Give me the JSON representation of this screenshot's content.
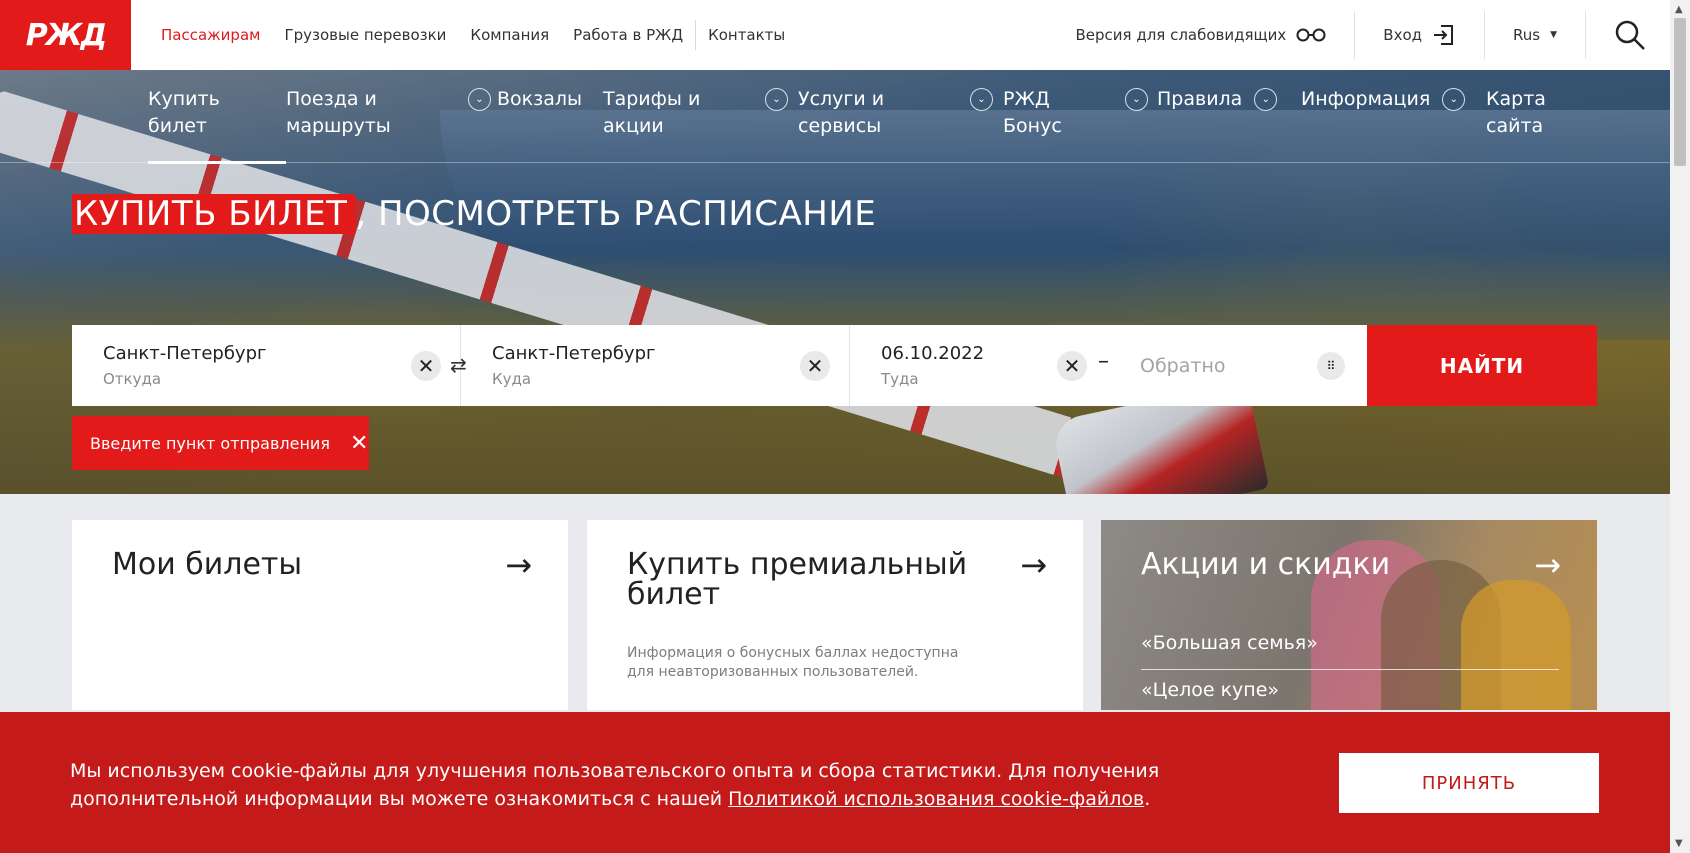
{
  "logo": {
    "text": "РЖД"
  },
  "top_nav": {
    "items": [
      "Пассажирам",
      "Грузовые перевозки",
      "Компания",
      "Работа в РЖД",
      "Контакты"
    ],
    "active_index": 0,
    "accent_color": "#e21a1a"
  },
  "top_right": {
    "accessibility": "Версия для слабовидящих",
    "login": "Вход",
    "language": "Rus"
  },
  "main_nav": [
    {
      "label": "Купить\nбилет",
      "line1": "Купить",
      "line2": "билет",
      "dropdown": false,
      "active": true
    },
    {
      "line1": "Поезда и",
      "line2": "маршруты",
      "dropdown": true
    },
    {
      "line1": "Вокзалы",
      "line2": "",
      "dropdown": false
    },
    {
      "line1": "Тарифы и",
      "line2": "акции",
      "dropdown": true
    },
    {
      "line1": "Услуги и",
      "line2": "сервисы",
      "dropdown": true
    },
    {
      "line1": "РЖД",
      "line2": "Бонус",
      "dropdown": true
    },
    {
      "line1": "Правила",
      "line2": "",
      "dropdown": true
    },
    {
      "line1": "Информация",
      "line2": "",
      "dropdown": true
    },
    {
      "line1": "Карта",
      "line2": "сайта",
      "dropdown": false
    }
  ],
  "hero": {
    "headline_highlight": "КУПИТЬ БИЛЕТ",
    "headline_rest": ", ПОСМОТРЕТЬ РАСПИСАНИЕ"
  },
  "search": {
    "from": {
      "value": "Санкт-Петербург",
      "label": "Откуда"
    },
    "to": {
      "value": "Санкт-Петербург",
      "label": "Куда"
    },
    "date_there": {
      "value": "06.10.2022",
      "label": "Туда"
    },
    "date_back": {
      "placeholder": "Обратно"
    },
    "submit_label": "НАЙТИ",
    "error": "Введите пункт отправления"
  },
  "cards": {
    "tickets": {
      "title": "Мои билеты"
    },
    "premium": {
      "title": "Купить премиальный билет",
      "note": "Информация о бонусных баллах недоступна для неавторизованных пользователей."
    },
    "promo": {
      "title": "Акции и скидки",
      "links": [
        "«Большая семья»",
        "«Целое купе»"
      ]
    }
  },
  "cookie": {
    "text": "Мы используем cookie-файлы для улучшения пользовательского опыта и сбора статистики. Для получения дополнительной информации вы можете ознакомиться с нашей ",
    "link": "Политикой использования cookie-файлов",
    "text_end": ".",
    "accept": "ПРИНЯТЬ",
    "background_color": "#c41a1a"
  }
}
